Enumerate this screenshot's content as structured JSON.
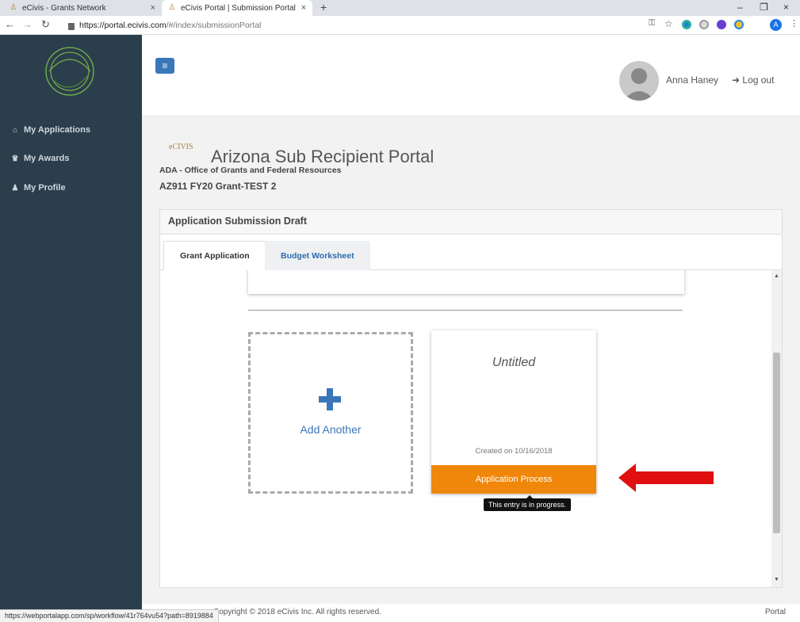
{
  "browser": {
    "tabs": [
      {
        "title": "eCivis - Grants Network"
      },
      {
        "title": "eCivis Portal | Submission Portal"
      }
    ],
    "new_tab": "+",
    "tab_close": "×",
    "url_host": "https://portal.ecivis.com",
    "url_path": "/#/index/submissionPortal",
    "profile_initial": "A",
    "window_min": "–",
    "window_max": "❐",
    "window_close": "×"
  },
  "sidebar": {
    "items": [
      {
        "label": "My Applications",
        "icon": "home-icon"
      },
      {
        "label": "My Awards",
        "icon": "trophy-icon"
      },
      {
        "label": "My Profile",
        "icon": "user-icon"
      }
    ]
  },
  "header": {
    "user_name": "Anna Haney",
    "logout_label": "Log out"
  },
  "portal": {
    "logo_text": "eCIVIS",
    "title": "Arizona Sub Recipient Portal",
    "org": "ADA - Office of Grants and Federal Resources",
    "grant": "AZ911 FY20 Grant-TEST 2"
  },
  "panel": {
    "heading": "Application Submission Draft",
    "tabs": [
      {
        "label": "Grant Application"
      },
      {
        "label": "Budget Worksheet"
      }
    ],
    "add_card_label": "Add Another",
    "entry": {
      "title": "Untitled",
      "created": "Created on 10/16/2018",
      "status": "Application Process",
      "tooltip": "This entry is in progress."
    }
  },
  "footer": {
    "copyright": "Copyright © 2018 eCivis Inc. All rights reserved.",
    "right": "Portal"
  },
  "status_url": "https://webportalapp.com/sp/workflow/41r764vu54?path=8919884",
  "colors": {
    "sidebar_bg": "#2b3e4c",
    "accent_blue": "#3a77b8",
    "status_orange": "#f0870a",
    "arrow_red": "#e01010"
  }
}
